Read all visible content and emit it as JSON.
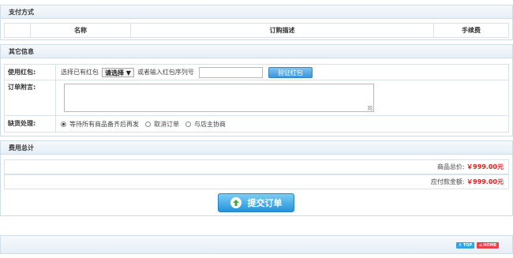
{
  "payment": {
    "title": "支付方式",
    "columns": [
      "",
      "名称",
      "订购描述",
      "手续费"
    ]
  },
  "other": {
    "title": "其它信息",
    "redpack": {
      "label": "使用红包:",
      "choose_text": "选择已有红包",
      "select_value": "请选择 ▼",
      "or_text": "或者输入红包序列号",
      "verify_button": "验证红包"
    },
    "note": {
      "label": "订单附言:"
    },
    "shortage": {
      "label": "缺货处理:",
      "options": [
        "等待所有商品备齐后再发",
        "取消订单",
        "与店主协商"
      ],
      "selected_index": 0
    }
  },
  "cost": {
    "title": "费用总计",
    "goods_total_label": "商品总价:",
    "goods_total_value": "￥999.00元",
    "payable_label": "应付款金额:",
    "payable_value": "￥999.00元",
    "submit_label": "提交订单"
  },
  "footer": {
    "top_tag": "⇑ TOP",
    "home_tag": "⌂ HOME"
  },
  "colors": {
    "accent_blue": "#2493d8",
    "price_red": "#e0201c"
  }
}
